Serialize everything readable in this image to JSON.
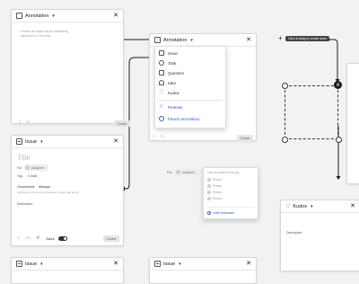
{
  "card_top_left": {
    "type_label": "Annotation",
    "caret": "▾",
    "close": "✕",
    "placeholder_line1": "Pursue an object about contacting",
    "placeholder_line2": "and quit in to see and",
    "send_label": "Create"
  },
  "card_center": {
    "type_label": "Annotation",
    "caret": "▾",
    "close": "✕",
    "send_label": "Create"
  },
  "type_menu": {
    "items": [
      {
        "label": "Issue",
        "icon": "issue-icon"
      },
      {
        "label": "Task",
        "icon": "task-icon"
      },
      {
        "label": "Question",
        "icon": "question-icon"
      },
      {
        "label": "Idea",
        "icon": "idea-icon"
      },
      {
        "label": "Kudos",
        "icon": "heart-icon"
      }
    ],
    "extra_items": [
      {
        "label": "Release",
        "icon": "star-icon"
      },
      {
        "label": "Parent annotation",
        "icon": "user-icon"
      }
    ]
  },
  "tooltip": {
    "text": "Click & drag to create area"
  },
  "selection_badge": "A",
  "issue_card": {
    "type_label": "Issue",
    "caret": "▾",
    "close": "✕",
    "title_placeholder": "Title",
    "for_label": "For",
    "for_value": "Assignee",
    "tag_label": "Tag",
    "tag_value": "Create",
    "tabs": [
      "Connections",
      "Manage"
    ],
    "links_hint": "Add links to connect annotations to other app areas",
    "description_label": "Description",
    "slack_label": "Slack",
    "send_label": "Create"
  },
  "assignee_popover": {
    "for_label": "For",
    "chip_label": "Assignee",
    "search_placeholder": "Look someone in the app",
    "people": [
      "Person",
      "Person",
      "Person",
      "Person"
    ],
    "invite_label": "Invite teammate"
  },
  "kudos_card": {
    "type_label": "Kudos",
    "caret": "▾",
    "close": "✕",
    "description_label": "Description"
  },
  "issue_card_bottom": {
    "type_label": "Issue",
    "caret": "▾",
    "close": "✕"
  },
  "issue_card_bottom_right": {
    "type_label": "Issue",
    "caret": "▾",
    "close": "✕"
  },
  "colors": {
    "accent_blue": "#2f5fcc",
    "connector": "#1a1a1a",
    "tooltip_bg": "#444444"
  }
}
